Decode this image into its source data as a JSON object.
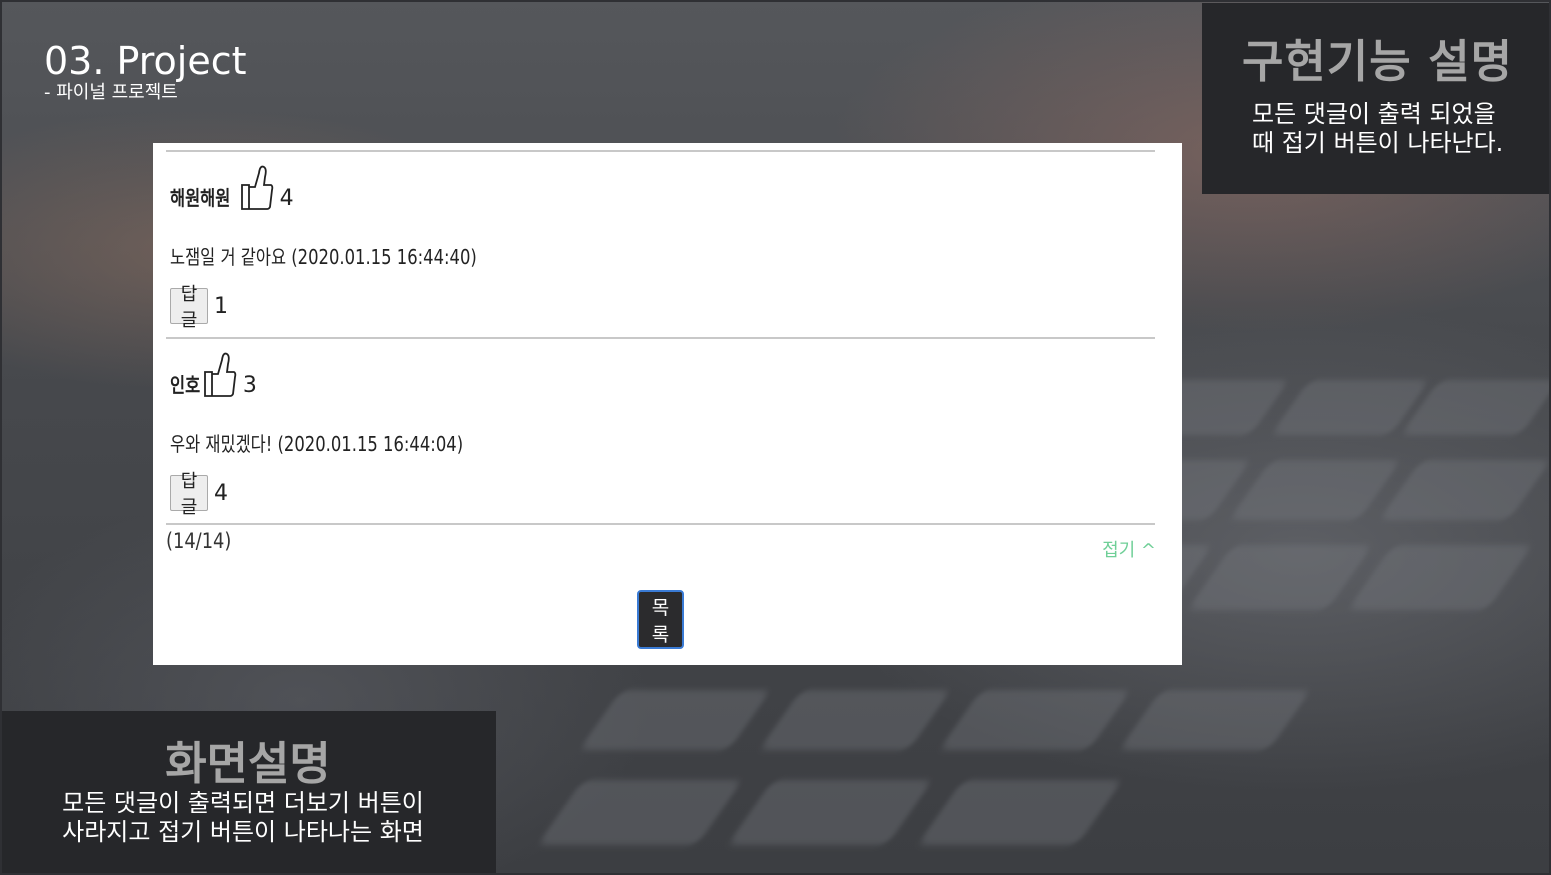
{
  "slide": {
    "title": "03. Project",
    "subtitle": "- 파이널 프로젝트"
  },
  "feature_panel": {
    "heading": "구현기능 설명",
    "description": "모든 댓글이 출력 되었을 때 접기 버튼이 나타난다."
  },
  "screen_panel": {
    "heading": "화면설명",
    "description_line1": "모든 댓글이 출력되면 더보기 버튼이",
    "description_line2": "사라지고 접기 버튼이 나타나는 화면"
  },
  "comments": [
    {
      "author": "해원해원",
      "likes": "4",
      "content": "노잼일 거 같아요 (2020.01.15 16:44:40)",
      "reply_label": "답글",
      "reply_count": "1"
    },
    {
      "author": "인호",
      "likes": "3",
      "content": "우와 재밌겠다! (2020.01.15 16:44:04)",
      "reply_label": "답글",
      "reply_count": "4"
    }
  ],
  "footer": {
    "count": "(14/14)",
    "fold_label": "접기 ^",
    "list_button": "목록"
  },
  "colors": {
    "fold_link": "#6fcf97",
    "list_button_border": "#3a7bd5",
    "panel_bg": "#26272a"
  }
}
